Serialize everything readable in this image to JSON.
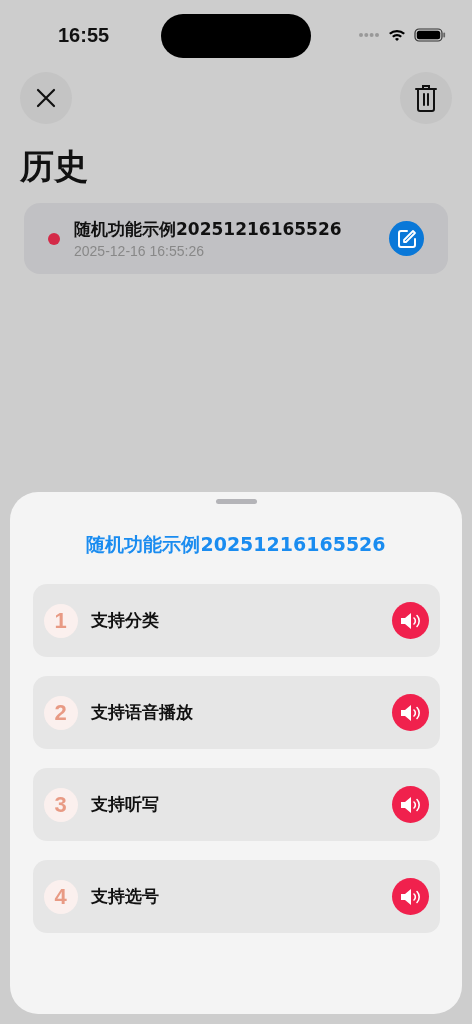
{
  "status_bar": {
    "time": "16:55"
  },
  "title": "历史",
  "history": [
    {
      "title": "随机功能示例20251216165526",
      "date": "2025-12-16 16:55:26",
      "color": "#d42a48"
    }
  ],
  "sheet": {
    "title": "随机功能示例20251216165526",
    "items": [
      {
        "number": "1",
        "label": "支持分类"
      },
      {
        "number": "2",
        "label": "支持语音播放"
      },
      {
        "number": "3",
        "label": "支持听写"
      },
      {
        "number": "4",
        "label": "支持选号"
      }
    ]
  }
}
